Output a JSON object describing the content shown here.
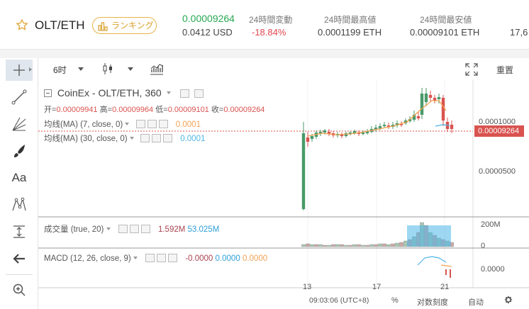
{
  "header": {
    "pair": "OLT/ETH",
    "ranking_label": "ランキング",
    "last_price": "0.00009264",
    "usd_price": "0.0412 USD",
    "change_label": "24時間変動",
    "change_value": "-18.84%",
    "high_label": "24時間最高値",
    "high_value": "0.0001199 ETH",
    "low_label": "24時間最安値",
    "low_value": "0.00009101 ETH",
    "cutoff_value": "17,6"
  },
  "toolbar": {
    "interval": "6时",
    "right_button": "重置"
  },
  "legend": {
    "title": "CoinEx - OLT/ETH, 360",
    "ohlc": {
      "open_label": "开=",
      "open": "0.00009941",
      "high_label": "高=",
      "high": "0.00009964",
      "low_label": "低=",
      "low": "0.00009101",
      "close_label": "收=",
      "close": "0.00009264"
    },
    "ma7_label": "均线(MA) (7, close, 0)",
    "ma7_value": "0.0001",
    "ma30_label": "均线(MA) (30, close, 0)",
    "ma30_value": "0.0001"
  },
  "volume": {
    "label": "成交量 (true, 20)",
    "value1": "1.592M",
    "value2": "53.025M"
  },
  "macd": {
    "label": "MACD (12, 26, close, 9)",
    "v1": "-0.0000",
    "v2": "0.0000",
    "v3": "0.0000"
  },
  "price_axis": {
    "tick1": "0.0001000",
    "tick2": "0.0000500",
    "current_price": "0.00009264",
    "volume_tick1": "200M",
    "volume_tick2": "0",
    "macd_tick": "0.0000"
  },
  "time_axis": [
    "13",
    "17",
    "21"
  ],
  "footer": {
    "time": "09:03:06 (UTC+8)",
    "percent": "%",
    "log": "对数刻度",
    "auto": "自动"
  },
  "colors": {
    "up": "#4a9a6a",
    "down": "#d9534f",
    "ma7": "#f2a253",
    "ma30": "#4db6e8",
    "accent_green": "#27a852",
    "accent_red": "#e0474f",
    "badge": "#d9a12c"
  }
}
